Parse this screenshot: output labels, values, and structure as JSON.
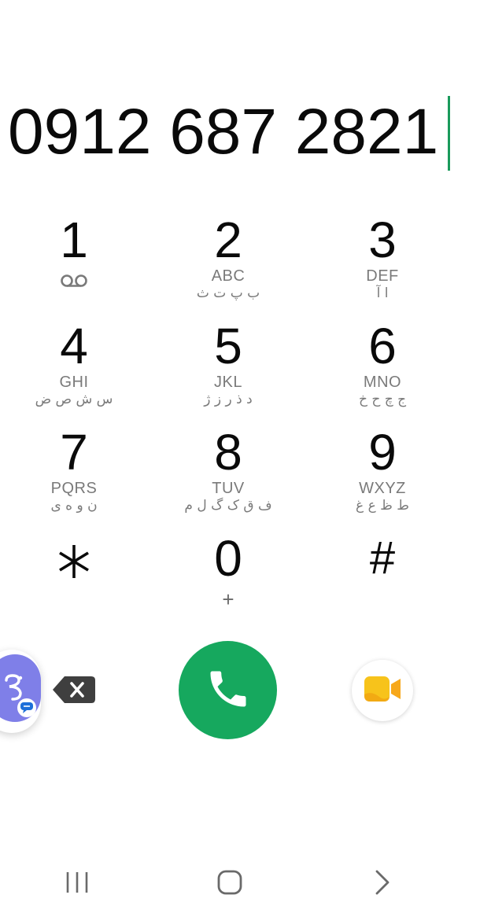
{
  "dialer": {
    "number": "0912 687 2821",
    "keys": [
      {
        "digit": "1",
        "latin": "",
        "persian": "",
        "extra": "voicemail-icon"
      },
      {
        "digit": "2",
        "latin": "ABC",
        "persian": "ب پ ت ث"
      },
      {
        "digit": "3",
        "latin": "DEF",
        "persian": "ا آ"
      },
      {
        "digit": "4",
        "latin": "GHI",
        "persian": "س ش ص ض"
      },
      {
        "digit": "5",
        "latin": "JKL",
        "persian": "د ذ ر ز ژ"
      },
      {
        "digit": "6",
        "latin": "MNO",
        "persian": "ج چ ح خ"
      },
      {
        "digit": "7",
        "latin": "PQRS",
        "persian": "ن و ه ی"
      },
      {
        "digit": "8",
        "latin": "TUV",
        "persian": "ف ق ک گ ل م"
      },
      {
        "digit": "9",
        "latin": "WXYZ",
        "persian": "ط ظ ع غ"
      },
      {
        "digit": "",
        "latin": "",
        "persian": "",
        "extra": "asterisk-icon"
      },
      {
        "digit": "0",
        "latin": "",
        "persian": "",
        "sub": "+"
      },
      {
        "digit": "#",
        "latin": "",
        "persian": ""
      }
    ]
  },
  "actions": {
    "bubble_icon": "chat-bubble-icon",
    "backspace_icon": "backspace-icon",
    "call_icon": "phone-icon",
    "video_icon": "video-call-icon"
  },
  "colors": {
    "call_green": "#16a85e",
    "cursor_green": "#1a9a5b",
    "bubble_purple": "#7f7fe8",
    "video_yellow": "#f7c31b",
    "secondary_text": "#7a7a7a"
  },
  "navbar": {
    "icons": [
      "recents-icon",
      "home-icon",
      "back-icon"
    ]
  }
}
